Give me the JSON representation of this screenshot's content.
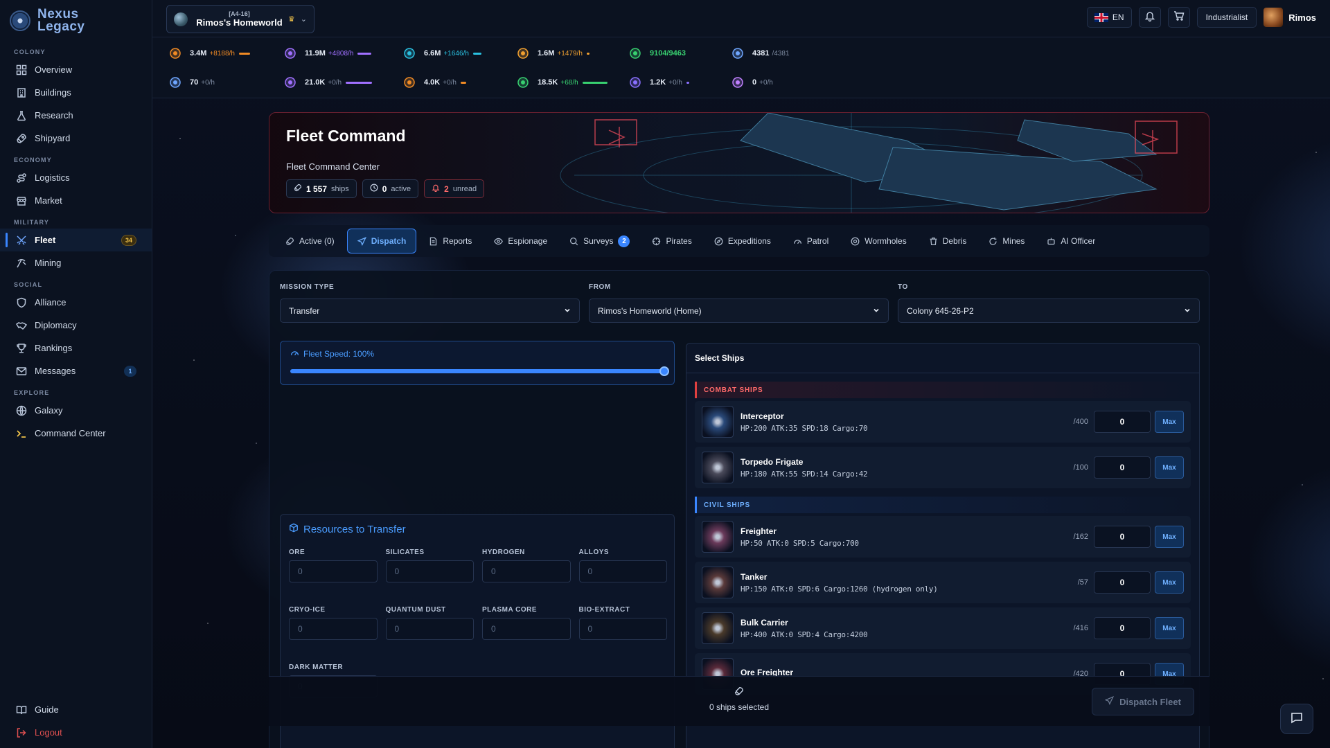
{
  "app": {
    "name_line1": "Nexus",
    "name_line2": "Legacy"
  },
  "sidebar": {
    "sections": {
      "colony": "COLONY",
      "economy": "ECONOMY",
      "military": "MILITARY",
      "social": "SOCIAL",
      "explore": "EXPLORE"
    },
    "items": {
      "overview": "Overview",
      "buildings": "Buildings",
      "research": "Research",
      "shipyard": "Shipyard",
      "logistics": "Logistics",
      "market": "Market",
      "fleet": "Fleet",
      "fleet_badge": "34",
      "mining": "Mining",
      "alliance": "Alliance",
      "diplomacy": "Diplomacy",
      "rankings": "Rankings",
      "messages": "Messages",
      "messages_badge": "1",
      "galaxy": "Galaxy",
      "command_center": "Command Center",
      "guide": "Guide",
      "logout": "Logout"
    }
  },
  "header": {
    "planet_coords": "[A4-16]",
    "planet_name": "Rimos's Homeworld",
    "language": "EN",
    "rank_button": "Industrialist",
    "username": "Rimos"
  },
  "resources": [
    {
      "value": "3.4M",
      "rate": "+8188/h",
      "color": "#f08a24",
      "icon": "ore-icon"
    },
    {
      "value": "11.9M",
      "rate": "+4808/h",
      "color": "#a070ff",
      "icon": "silicates-icon"
    },
    {
      "value": "6.6M",
      "rate": "+1646/h",
      "color": "#2ac0e0",
      "icon": "hydrogen-icon"
    },
    {
      "value": "1.6M",
      "rate": "+1479/h",
      "color": "#f0a030",
      "icon": "alloys-icon"
    },
    {
      "value": "9104/9463",
      "rate": "",
      "color": "#38d070",
      "icon": "energy-icon"
    },
    {
      "value": "4381",
      "rate": "/4381",
      "color": "#6fa6ff",
      "icon": "population-icon"
    },
    {
      "value": "70",
      "rate": "+0/h",
      "color": "#6fa6ff",
      "icon": "cryo-ice-icon"
    },
    {
      "value": "21.0K",
      "rate": "+0/h",
      "color": "#a070ff",
      "icon": "quantum-dust-icon"
    },
    {
      "value": "4.0K",
      "rate": "+0/h",
      "color": "#f08a24",
      "icon": "plasma-core-icon"
    },
    {
      "value": "18.5K",
      "rate": "+68/h",
      "color": "#38d070",
      "icon": "bio-extract-icon"
    },
    {
      "value": "1.2K",
      "rate": "+0/h",
      "color": "#8a70ff",
      "icon": "dark-matter-icon"
    },
    {
      "value": "0",
      "rate": "+0/h",
      "color": "#c080ff",
      "icon": "exotic-icon"
    }
  ],
  "banner": {
    "title": "Fleet Command",
    "subtitle": "Fleet Command Center",
    "ships_count": "1 557",
    "ships_label": "ships",
    "active_count": "0",
    "active_label": "active",
    "unread_count": "2",
    "unread_label": "unread"
  },
  "tabs": {
    "active": "Active (0)",
    "dispatch": "Dispatch",
    "reports": "Reports",
    "espionage": "Espionage",
    "surveys": "Surveys",
    "surveys_badge": "2",
    "pirates": "Pirates",
    "expeditions": "Expeditions",
    "patrol": "Patrol",
    "wormholes": "Wormholes",
    "debris": "Debris",
    "mines": "Mines",
    "ai_officer": "AI Officer"
  },
  "dispatch": {
    "mission_type_label": "MISSION TYPE",
    "mission_type_value": "Transfer",
    "from_label": "FROM",
    "from_value": "Rimos's Homeworld (Home)",
    "to_label": "TO",
    "to_value": "Colony 645-26-P2",
    "speed_label": "Fleet Speed: 100%",
    "speed_fraction": 1.0,
    "resources_title": "Resources to Transfer",
    "resources": [
      {
        "label": "ORE",
        "placeholder": "0"
      },
      {
        "label": "SILICATES",
        "placeholder": "0"
      },
      {
        "label": "HYDROGEN",
        "placeholder": "0"
      },
      {
        "label": "ALLOYS",
        "placeholder": "0"
      },
      {
        "label": "CRYO-ICE",
        "placeholder": "0"
      },
      {
        "label": "QUANTUM DUST",
        "placeholder": "0"
      },
      {
        "label": "PLASMA CORE",
        "placeholder": "0"
      },
      {
        "label": "BIO-EXTRACT",
        "placeholder": "0"
      },
      {
        "label": "DARK MATTER",
        "placeholder": "0"
      }
    ],
    "select_ships_title": "Select Ships",
    "combat_label": "COMBAT SHIPS",
    "civil_label": "CIVIL SHIPS",
    "max_label": "Max",
    "combat_ships": [
      {
        "name": "Interceptor",
        "stats": "HP:200 ATK:35 SPD:18 Cargo:70",
        "avail": "/400",
        "qty": "0"
      },
      {
        "name": "Torpedo Frigate",
        "stats": "HP:180 ATK:55 SPD:14 Cargo:42",
        "avail": "/100",
        "qty": "0"
      }
    ],
    "civil_ships": [
      {
        "name": "Freighter",
        "stats": "HP:50 ATK:0 SPD:5 Cargo:700",
        "avail": "/162",
        "qty": "0"
      },
      {
        "name": "Tanker",
        "stats": "HP:150 ATK:0 SPD:6 Cargo:1260 (hydrogen only)",
        "avail": "/57",
        "qty": "0"
      },
      {
        "name": "Bulk Carrier",
        "stats": "HP:400 ATK:0 SPD:4 Cargo:4200",
        "avail": "/416",
        "qty": "0"
      },
      {
        "name": "Ore Freighter",
        "stats": "",
        "avail": "/420",
        "qty": "0"
      }
    ],
    "ships_selected": "0 ships selected",
    "dispatch_button": "Dispatch Fleet"
  }
}
